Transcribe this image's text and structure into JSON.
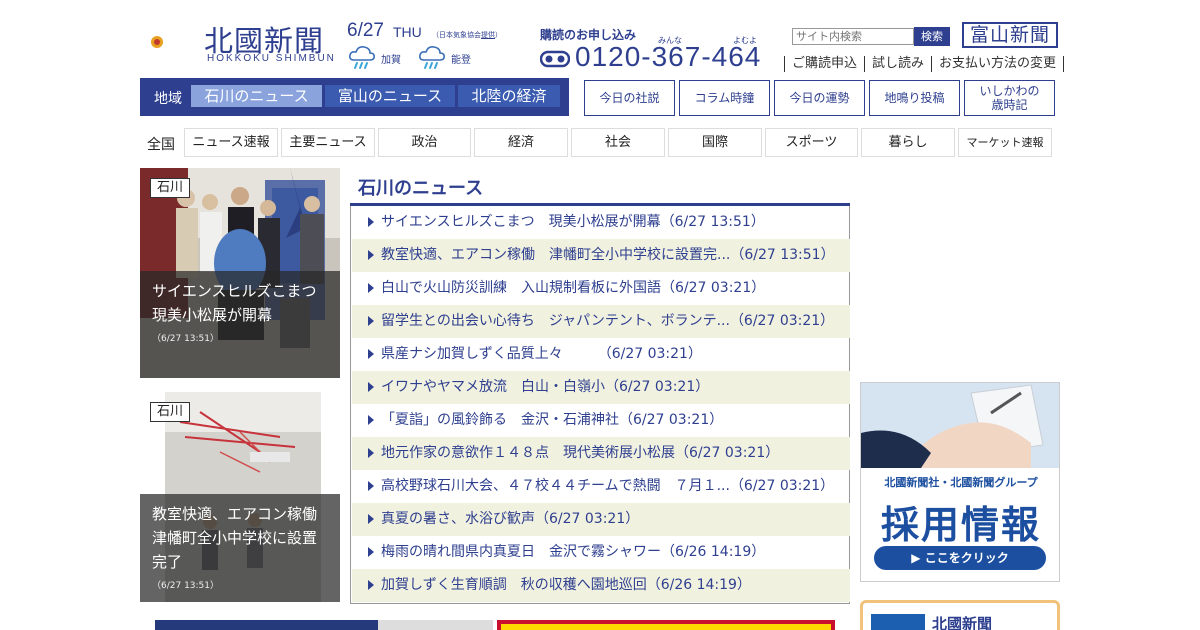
{
  "header": {
    "logo_kanji": "北國新聞",
    "logo_roman": "HOKKOKU SHIMBUN",
    "date": "6/27",
    "weekday": "THU",
    "weather_credit_prefix": "（日本気象協会",
    "weather_credit_link": "提供",
    "weather_credit_suffix": "）",
    "weather": [
      {
        "area": "加賀",
        "icon": "rain-cloud-icon"
      },
      {
        "area": "能登",
        "icon": "rain-cloud-icon"
      }
    ],
    "subscribe_label": "購読のお申し込み",
    "phone_ruby": [
      "みんな",
      "よむよ"
    ],
    "phone_number": "0120-367-464",
    "search_placeholder": "サイト内検索",
    "search_button": "検索",
    "toyama_label": "富山新聞",
    "links": [
      "ご購読申込",
      "試し読み",
      "お支払い方法の変更"
    ]
  },
  "region_nav": {
    "label": "地域",
    "tabs": [
      {
        "label": "石川のニュース",
        "active": true
      },
      {
        "label": "富山のニュース",
        "active": false
      },
      {
        "label": "北陸の経済",
        "active": false
      }
    ]
  },
  "quick_links": [
    "今日の社説",
    "コラム時鐘",
    "今日の運勢",
    "地鳴り投稿",
    "いしかわの",
    "歳時記"
  ],
  "category_nav": {
    "label": "全国",
    "items": [
      "ニュース速報",
      "主要ニュース",
      "政治",
      "経済",
      "社会",
      "国際",
      "スポーツ",
      "暮らし",
      "マーケット速報"
    ]
  },
  "features": [
    {
      "tag": "石川",
      "title": "サイエンスヒルズこまつ　現美小松展が開幕",
      "time": "（6/27 13:51）"
    },
    {
      "tag": "石川",
      "title": "教室快適、エアコン稼働　津幡町全小中学校に設置完了",
      "time": "（6/27 13:51）"
    }
  ],
  "news": {
    "heading": "石川のニュース",
    "items": [
      {
        "title": "サイエンスヒルズこまつ　現美小松展が開幕",
        "time": "（6/27 13:51）"
      },
      {
        "title": "教室快適、エアコン稼働　津幡町全小中学校に設置完...",
        "time": "（6/27 13:51）"
      },
      {
        "title": "白山で火山防災訓練　入山規制看板に外国語",
        "time": "（6/27 03:21）"
      },
      {
        "title": "留学生との出会い心待ち　ジャパンテント、ボランテ...",
        "time": "（6/27 03:21）"
      },
      {
        "title": "県産ナシ加賀しずく品質上々　　　",
        "time": "（6/27 03:21）"
      },
      {
        "title": "イワナやヤマメ放流　白山・白嶺小",
        "time": "（6/27 03:21）"
      },
      {
        "title": "「夏詣」の風鈴飾る　金沢・石浦神社",
        "time": "（6/27 03:21）"
      },
      {
        "title": "地元作家の意欲作１４８点　現代美術展小松展",
        "time": "（6/27 03:21）"
      },
      {
        "title": "高校野球石川大会、４７校４４チームで熱闘　７月１...",
        "time": "（6/27 03:21）"
      },
      {
        "title": "真夏の暑さ、水浴び歓声",
        "time": "（6/27 03:21）"
      },
      {
        "title": "梅雨の晴れ間県内真夏日　金沢で霧シャワー",
        "time": "（6/26 14:19）"
      },
      {
        "title": "加賀しずく生育順調　秋の収穫へ園地巡回",
        "time": "（6/26 14:19）"
      }
    ]
  },
  "recruit_banner": {
    "subtitle": "北國新聞社・北國新聞グループ",
    "title": "採用情報",
    "button": "▶ ここをクリック"
  },
  "bunko_banner": {
    "title": "北國新聞"
  },
  "colors": {
    "brand_navy": "#2e3f8f",
    "tab_active": "#8aa3dd",
    "row_alt": "#f1f1e0",
    "recruit_blue": "#1c4fa0"
  }
}
